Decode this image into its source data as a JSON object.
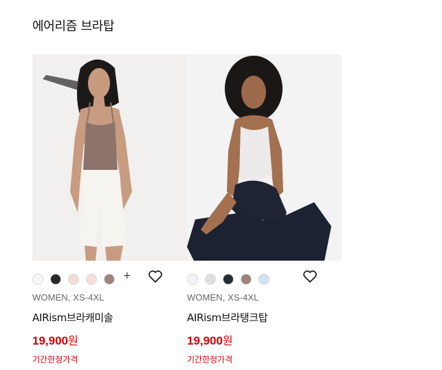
{
  "section": {
    "title": "에어리즘 브라탑"
  },
  "colors": {
    "price_red": "#d40000",
    "photo_bg_1": "#f1f0ef",
    "photo_bg_2": "#f3f3f3"
  },
  "products": [
    {
      "swatches": [
        {
          "color": "#f6f6f6",
          "name": "white"
        },
        {
          "color": "#26282b",
          "name": "black"
        },
        {
          "color": "#f3dcd7",
          "name": "light-pink"
        },
        {
          "color": "#f4e2d6",
          "name": "beige"
        },
        {
          "color": "#a0857c",
          "name": "brown"
        }
      ],
      "more_colors": "+",
      "meta": "WOMEN, XS-4XL",
      "name": "AIRism브라캐미솔",
      "price": "19,900",
      "currency": "원",
      "flag": "기간한정가격",
      "favorite_icon": "heart-outline-icon"
    },
    {
      "swatches": [
        {
          "color": "#f2f3f6",
          "name": "white"
        },
        {
          "color": "#dfdfdf",
          "name": "gray"
        },
        {
          "color": "#2a2c33",
          "name": "black"
        },
        {
          "color": "#9b8478",
          "name": "brown"
        },
        {
          "color": "#cfe2f2",
          "name": "light-blue"
        }
      ],
      "meta": "WOMEN, XS-4XL",
      "name": "AIRism브라탱크탑",
      "price": "19,900",
      "currency": "원",
      "flag": "기간한정가격",
      "favorite_icon": "heart-outline-icon"
    }
  ]
}
